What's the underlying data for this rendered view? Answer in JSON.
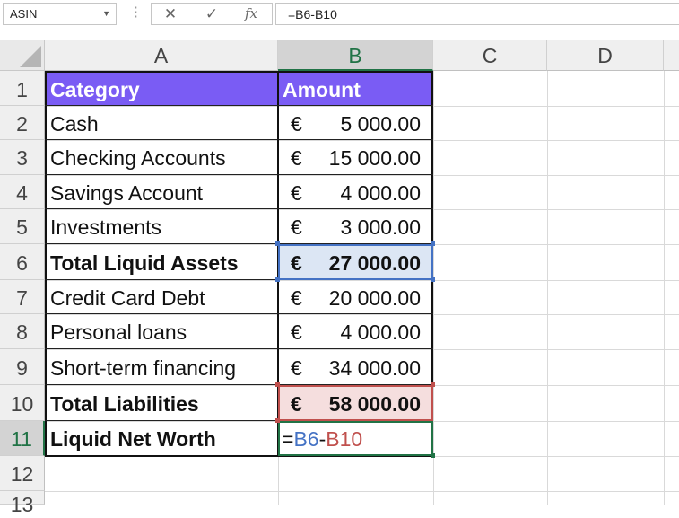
{
  "formula_bar": {
    "name_box": "ASIN",
    "formula": "=B6-B10",
    "cancel_icon": "x-icon",
    "enter_icon": "check-icon",
    "fx_label": "fx"
  },
  "columns": [
    "A",
    "B",
    "C",
    "D"
  ],
  "rows": [
    "1",
    "2",
    "3",
    "4",
    "5",
    "6",
    "7",
    "8",
    "9",
    "10",
    "11",
    "12",
    "13"
  ],
  "table": {
    "header": {
      "category": "Category",
      "amount": "Amount"
    },
    "rows": [
      {
        "category": "Cash",
        "currency": "€",
        "amount": "5 000.00"
      },
      {
        "category": "Checking Accounts",
        "currency": "€",
        "amount": "15 000.00"
      },
      {
        "category": "Savings Account",
        "currency": "€",
        "amount": "4 000.00"
      },
      {
        "category": "Investments",
        "currency": "€",
        "amount": "3 000.00"
      },
      {
        "category": "Total Liquid Assets",
        "currency": "€",
        "amount": "27 000.00"
      },
      {
        "category": "Credit Card  Debt",
        "currency": "€",
        "amount": "20 000.00"
      },
      {
        "category": "Personal loans",
        "currency": "€",
        "amount": "4 000.00"
      },
      {
        "category": "Short-term financing",
        "currency": "€",
        "amount": "34 000.00"
      },
      {
        "category": "Total Liabilities",
        "currency": "€",
        "amount": "58 000.00"
      }
    ],
    "net_worth": {
      "label": "Liquid Net Worth",
      "formula_eq": "=",
      "formula_ref1": "B6",
      "formula_op": "-",
      "formula_ref2": "B10"
    }
  },
  "colors": {
    "header_bg": "#7a5cf4",
    "ref1": "#4472c4",
    "ref2": "#c0504d",
    "active": "#217346"
  }
}
